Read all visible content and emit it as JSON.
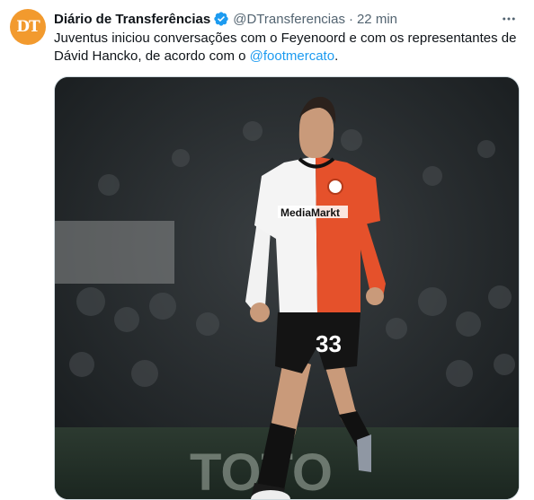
{
  "tweet": {
    "avatar_text": "DT",
    "display_name": "Diário de Transferências",
    "handle": "@DTransferencias",
    "separator": "·",
    "time": "22 min",
    "text_before": "Juventus iniciou conversações com o Feyenoord e com os representantes de Dávid Hancko, de acordo com o ",
    "mention": "@footmercato",
    "text_after": "."
  },
  "media": {
    "shirt_sponsor": "MediaMarkt",
    "shorts_number": "33",
    "board_text": "TOTO",
    "accent_colors": {
      "shirt_red": "#e5512b",
      "brand_orange": "#f29a2e",
      "link_blue": "#1d9bf0"
    }
  },
  "icons": {
    "verified": "verified-badge-icon",
    "more": "more-options-icon"
  }
}
